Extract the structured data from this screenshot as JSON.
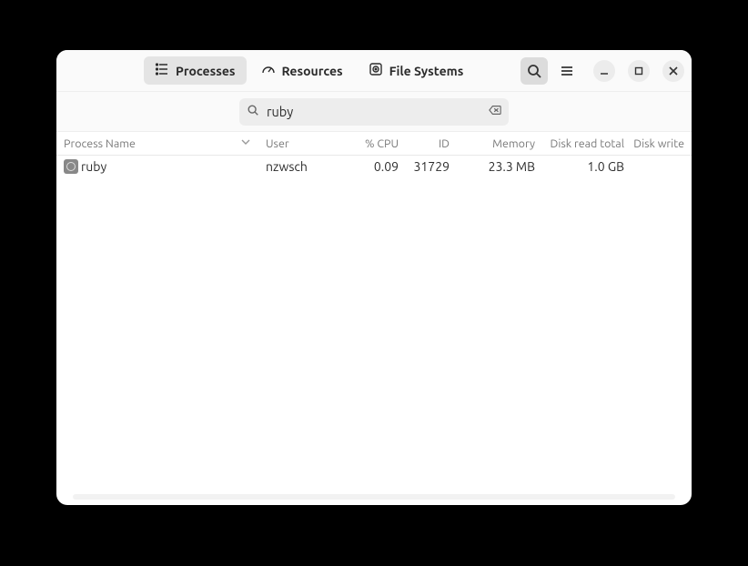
{
  "tabs": {
    "processes": "Processes",
    "resources": "Resources",
    "filesystems": "File Systems"
  },
  "search": {
    "value": "ruby"
  },
  "columns": {
    "name": "Process Name",
    "user": "User",
    "cpu": "% CPU",
    "id": "ID",
    "memory": "Memory",
    "disk_read": "Disk read total",
    "disk_write": "Disk write"
  },
  "rows": [
    {
      "name": "ruby",
      "user": "nzwsch",
      "cpu": "0.09",
      "id": "31729",
      "memory": "23.3 MB",
      "disk_read": "1.0 GB",
      "disk_write": ""
    }
  ]
}
